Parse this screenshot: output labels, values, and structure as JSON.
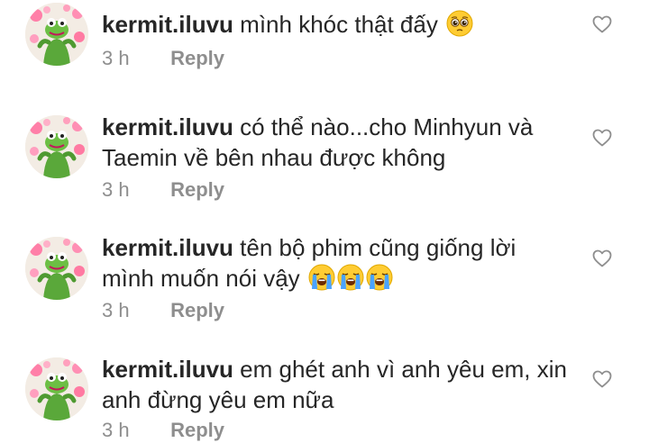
{
  "comments": [
    {
      "username": "kermit.iluvu",
      "text": "mình khóc thật đấy",
      "emojis": [
        "pleading-face"
      ],
      "time": "3 h",
      "reply_label": "Reply"
    },
    {
      "username": "kermit.iluvu",
      "text": "có thể nào...cho Minhyun và Taemin về bên nhau được không",
      "emojis": [],
      "time": "3 h",
      "reply_label": "Reply"
    },
    {
      "username": "kermit.iluvu",
      "text": "tên bộ phim cũng giống lời mình muốn nói vậy",
      "emojis": [
        "loudly-crying-face",
        "loudly-crying-face",
        "loudly-crying-face"
      ],
      "time": "3 h",
      "reply_label": "Reply"
    },
    {
      "username": "kermit.iluvu",
      "text": "em ghét anh vì anh yêu em, xin anh đừng yêu em nữa",
      "emojis": [],
      "time": "3 h",
      "reply_label": "Reply"
    }
  ],
  "icons": {
    "like": "heart-outline-icon",
    "avatar": "kermit-frog-with-hearts"
  },
  "colors": {
    "text": "#262626",
    "secondary": "#8e8e8e",
    "background": "#ffffff"
  }
}
